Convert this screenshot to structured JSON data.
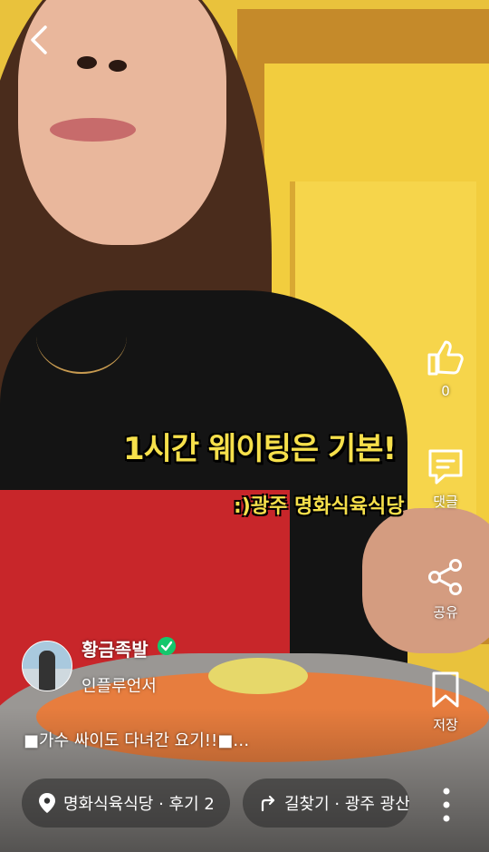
{
  "header": {
    "back_icon": "chevron-left-icon"
  },
  "overlay": {
    "caption_main": "1시간 웨이팅은 기본!",
    "caption_sub": ":)광주 명화식육식당"
  },
  "actions": {
    "like": {
      "icon": "thumbs-up-icon",
      "count": "0"
    },
    "comment": {
      "icon": "comment-icon",
      "label": "댓글"
    },
    "share": {
      "icon": "share-icon",
      "label": "공유"
    },
    "save": {
      "icon": "bookmark-icon",
      "label": "저장"
    }
  },
  "author": {
    "name": "황금족발",
    "role": "인플루언서",
    "verified_color": "#14c76c"
  },
  "description": "■가수 싸이도 다녀간 요기!!■…",
  "chips": {
    "place": {
      "icon": "location-pin-icon",
      "label": "명화식육식당 · 후기 2"
    },
    "route": {
      "icon": "route-arrow-icon",
      "label": "길찾기 · 광주 광산구"
    }
  },
  "more_icon": "more-vertical-icon"
}
